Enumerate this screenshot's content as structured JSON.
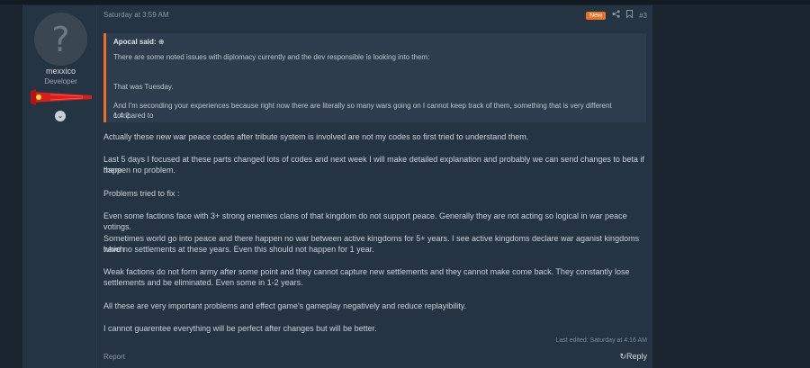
{
  "user": {
    "avatar_glyph": "?",
    "name": "mexxico",
    "title": "Developer",
    "expand_glyph": "⌄"
  },
  "post": {
    "date": "Saturday at 3:59 AM",
    "badge": "New",
    "share_icon": "share-icon",
    "bookmark_icon": "bookmark-icon",
    "number": "#3",
    "quote": {
      "author": "Apocal said:",
      "author_icon": "⊕",
      "lines": [
        "There are some noted issues with diplomacy currently and the dev responsible is looking into them:",
        "That was Tuesday.",
        "And I'm seconding your experiences because right now there are literally so many wars going on I cannot keep track of them, something that is very different compared to",
        "1.4.2."
      ]
    },
    "paragraphs": [
      "Actually these new war peace codes after tribute system is involved are not my codes so first tried to understand them.",
      "Last 5 days I focused at these parts changed lots of codes and next week I will make detailed explanation and probably we can send changes to beta if there",
      "happen no problem.",
      "Problems tried to fix :",
      "Even some factions face with 3+ strong enemies clans of that kingdom do not support peace. Generally they are not acting so logical in war peace votings.",
      "Sometimes world go into peace and there happen no war between active kingdoms for 5+ years. I see active kingdoms declare war aganist kingdoms which",
      "have no settlements at these years. Even this should not happen for 1 year.",
      "Weak factions do not form army after some point and they cannot capture new settlements and they cannot make come back. They constantly lose",
      "settlements and be eliminated. Even some in 1-2 years.",
      "All these are very important problems and effect game's gameplay negatively and reduce replayibility.",
      "I cannot guarentee everything will be perfect after changes but will be better."
    ],
    "last_edited": "Last edited: Saturday at 4:16 AM",
    "report_label": "Report",
    "reply_label": "Reply",
    "reply_icon": "↻"
  },
  "colors": {
    "accent": "#e8702a",
    "post_bg": "#253442",
    "page_bg": "#1b2530",
    "quote_bg": "#2d3d4d"
  }
}
